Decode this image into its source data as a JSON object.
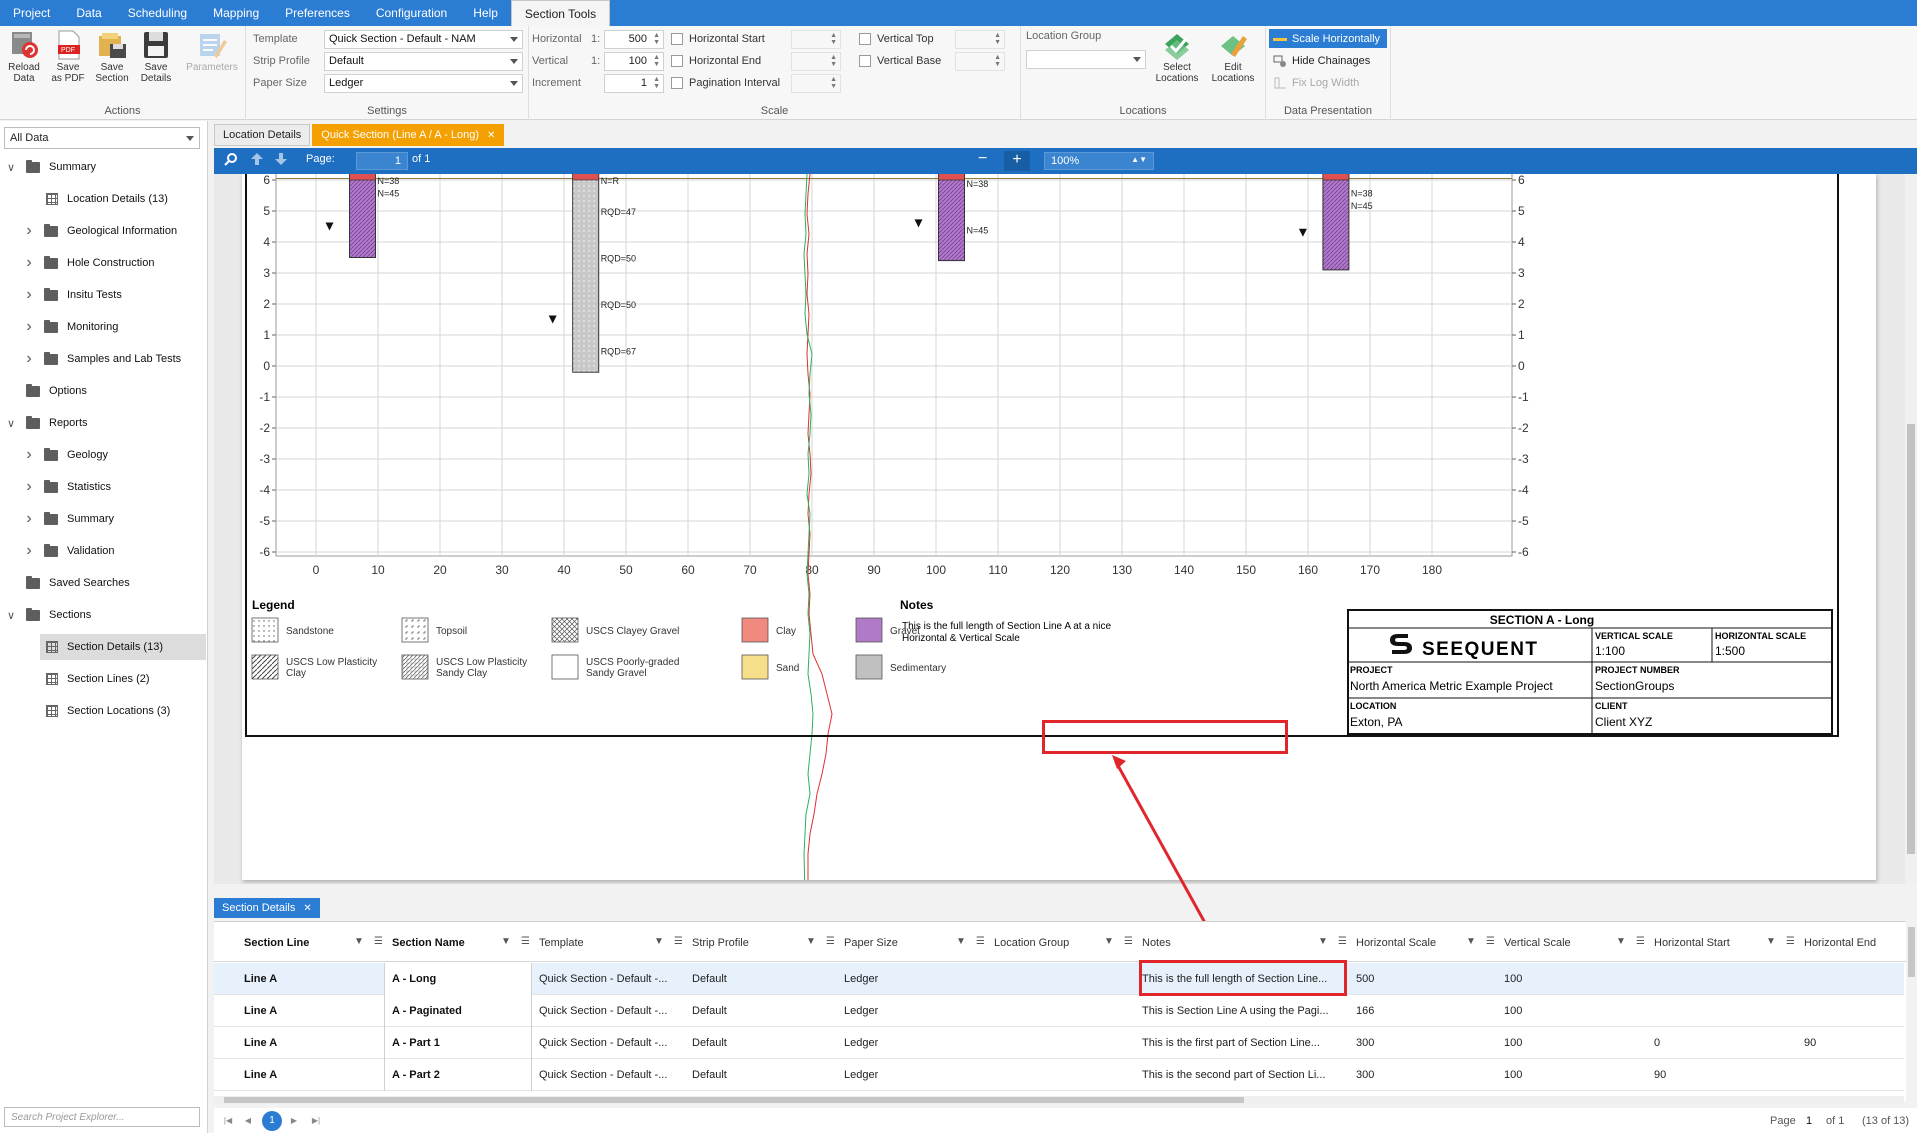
{
  "menu": [
    "Project",
    "Data",
    "Scheduling",
    "Mapping",
    "Preferences",
    "Configuration",
    "Help",
    "Section Tools"
  ],
  "ribbon": {
    "actions": {
      "title": "Actions",
      "buttons": [
        {
          "line1": "Reload",
          "line2": "Data"
        },
        {
          "line1": "Save",
          "line2": "as PDF"
        },
        {
          "line1": "Save",
          "line2": "Section"
        },
        {
          "line1": "Save",
          "line2": "Details"
        },
        {
          "line1": "Parameters",
          "line2": ""
        }
      ]
    },
    "settings": {
      "title": "Settings",
      "template_label": "Template",
      "template_value": "Quick Section - Default - NAM",
      "strip_label": "Strip Profile",
      "strip_value": "Default",
      "paper_label": "Paper Size",
      "paper_value": "Ledger"
    },
    "scale": {
      "title": "Scale",
      "horizontal_label": "Horizontal",
      "horizontal_ratio": "1:",
      "horizontal_value": "500",
      "vertical_label": "Vertical",
      "vertical_ratio": "1:",
      "vertical_value": "100",
      "increment_label": "Increment",
      "increment_value": "1",
      "horizontal_start": "Horizontal Start",
      "horizontal_end": "Horizontal End",
      "pagination_interval": "Pagination Interval",
      "vertical_top": "Vertical Top",
      "vertical_base": "Vertical Base"
    },
    "locations": {
      "title": "Locations",
      "location_group_label": "Location Group",
      "select_line1": "Select",
      "select_line2": "Locations",
      "edit_line1": "Edit",
      "edit_line2": "Locations"
    },
    "presentation": {
      "title": "Data Presentation",
      "scale_horizontally": "Scale Horizontally",
      "hide_chainages": "Hide Chainages",
      "fix_log_width": "Fix Log Width"
    }
  },
  "left": {
    "filter": "All Data",
    "search_placeholder": "Search Project Explorer...",
    "tree": [
      {
        "label": "Summary",
        "chev": "v",
        "icon": "folder",
        "level": 0
      },
      {
        "label": "Location Details (13)",
        "chev": "",
        "icon": "grid",
        "level": 2
      },
      {
        "label": "Geological Information",
        "chev": ">",
        "icon": "folder",
        "level": 1
      },
      {
        "label": "Hole Construction",
        "chev": ">",
        "icon": "folder",
        "level": 1
      },
      {
        "label": "Insitu Tests",
        "chev": ">",
        "icon": "folder",
        "level": 1
      },
      {
        "label": "Monitoring",
        "chev": ">",
        "icon": "folder",
        "level": 1
      },
      {
        "label": "Samples and Lab Tests",
        "chev": ">",
        "icon": "folder",
        "level": 1
      },
      {
        "label": "Options",
        "chev": "",
        "icon": "folder",
        "level": 0
      },
      {
        "label": "Reports",
        "chev": "v",
        "icon": "folder",
        "level": 0
      },
      {
        "label": "Geology",
        "chev": ">",
        "icon": "folder",
        "level": 1
      },
      {
        "label": "Statistics",
        "chev": ">",
        "icon": "folder",
        "level": 1
      },
      {
        "label": "Summary",
        "chev": ">",
        "icon": "folder",
        "level": 1
      },
      {
        "label": "Validation",
        "chev": ">",
        "icon": "folder",
        "level": 1
      },
      {
        "label": "Saved Searches",
        "chev": "",
        "icon": "folder",
        "level": 0
      },
      {
        "label": "Sections",
        "chev": "v",
        "icon": "folder",
        "level": 0
      },
      {
        "label": "Section Details (13)",
        "chev": "",
        "icon": "grid",
        "level": 2,
        "selected": true
      },
      {
        "label": "Section Lines (2)",
        "chev": "",
        "icon": "grid",
        "level": 2
      },
      {
        "label": "Section Locations (3)",
        "chev": "",
        "icon": "grid",
        "level": 2
      }
    ]
  },
  "tabs": {
    "location_details": "Location Details",
    "quick_section": "Quick Section (Line A / A - Long)"
  },
  "viewer": {
    "page_label": "Page:",
    "page_value": "1",
    "page_of": "of 1",
    "zoom": "100%",
    "minus": "−",
    "plus": "+"
  },
  "section": {
    "y_ticks": [
      "6",
      "5",
      "4",
      "3",
      "2",
      "1",
      "0",
      "-1",
      "-2",
      "-3",
      "-4",
      "-5",
      "-6"
    ],
    "x_ticks": [
      "0",
      "10",
      "20",
      "30",
      "40",
      "50",
      "60",
      "70",
      "80",
      "90",
      "100",
      "110",
      "120",
      "130",
      "140",
      "150",
      "160",
      "170",
      "180"
    ],
    "boreholes": [
      {
        "x_m": 7.5,
        "top_rl": 6.3,
        "base_rl": 3.5,
        "fill": "gravel",
        "water_rl": 4.5,
        "labels": [
          {
            "rl": 6.0,
            "text": "N=38"
          },
          {
            "rl": 5.6,
            "text": "N=45"
          }
        ]
      },
      {
        "x_m": 43.5,
        "top_rl": 6.3,
        "base_rl": -0.2,
        "fill": "rock",
        "water_rl": 1.5,
        "labels": [
          {
            "rl": 6.0,
            "text": "N=R"
          },
          {
            "rl": 5.0,
            "text": "RQD=47"
          },
          {
            "rl": 3.5,
            "text": "RQD=50"
          },
          {
            "rl": 2.0,
            "text": "RQD=50"
          },
          {
            "rl": 0.5,
            "text": "RQD=67"
          }
        ]
      },
      {
        "x_m": 102.5,
        "top_rl": 6.3,
        "base_rl": 3.4,
        "fill": "gravel",
        "water_rl": 4.6,
        "labels": [
          {
            "rl": 5.9,
            "text": "N=38"
          },
          {
            "rl": 4.4,
            "text": "N=45"
          }
        ]
      },
      {
        "x_m": 164.5,
        "top_rl": 6.3,
        "base_rl": 3.1,
        "fill": "gravel",
        "water_rl": 4.3,
        "labels": [
          {
            "rl": 5.6,
            "text": "N=38"
          },
          {
            "rl": 5.2,
            "text": "N=45"
          }
        ]
      }
    ],
    "legend_title": "Legend",
    "legend": [
      {
        "label": "Sandstone",
        "pattern": "dots"
      },
      {
        "label": "Topsoil",
        "pattern": "topsoil"
      },
      {
        "label": "USCS Clayey Gravel",
        "pattern": "cross"
      },
      {
        "label": "Clay",
        "color": "#f08a7e"
      },
      {
        "label": "Gravel",
        "color": "#b07ac9"
      },
      {
        "label": "USCS Low Plasticity Clay",
        "label2": "",
        "pattern": "hatch"
      },
      {
        "label": "USCS Low Plasticity",
        "label2": "Sandy Clay",
        "pattern": "hatch2"
      },
      {
        "label": "USCS Poorly-graded",
        "label2": "Sandy Gravel",
        "pattern": "cross2"
      },
      {
        "label": "Sand",
        "color": "#f6de8a"
      },
      {
        "label": "Sedimentary",
        "color": "#c0c0c0"
      }
    ],
    "notes_title": "Notes",
    "notes_line1": "This is the full length of Section Line A at a nice",
    "notes_line2": "Horizontal & Vertical Scale",
    "title_block": {
      "title": "SECTION A - Long",
      "logo": "SEEQUENT",
      "vscale_label": "VERTICAL SCALE",
      "vscale_value": "1:100",
      "hscale_label": "HORIZONTAL SCALE",
      "hscale_value": "1:500",
      "project_label": "PROJECT",
      "project_value": "North America Metric Example Project",
      "projno_label": "PROJECT NUMBER",
      "projno_value": "SectionGroups",
      "location_label": "LOCATION",
      "location_value": "Exton, PA",
      "client_label": "CLIENT",
      "client_value": "Client XYZ"
    }
  },
  "grid": {
    "tab": "Section Details",
    "columns": [
      "Section Line",
      "Section Name",
      "Template",
      "Strip Profile",
      "Paper Size",
      "Location Group",
      "Notes",
      "Horizontal Scale",
      "Vertical Scale",
      "Horizontal Start",
      "Horizontal End"
    ],
    "rows": [
      [
        "Line A",
        "A - Long",
        "Quick Section - Default -...",
        "Default",
        "Ledger",
        "",
        "This is the full length of Section Line...",
        "500",
        "100",
        "",
        ""
      ],
      [
        "Line A",
        "A - Paginated",
        "Quick Section - Default -...",
        "Default",
        "Ledger",
        "",
        "This is Section Line A using the Pagi...",
        "166",
        "100",
        "",
        ""
      ],
      [
        "Line A",
        "A - Part 1",
        "Quick Section - Default -...",
        "Default",
        "Ledger",
        "",
        "This is the first part of Section Line...",
        "300",
        "100",
        "0",
        "90"
      ],
      [
        "Line A",
        "A - Part 2",
        "Quick Section - Default -...",
        "Default",
        "Ledger",
        "",
        "This is the second part of Section Li...",
        "300",
        "100",
        "90",
        ""
      ]
    ]
  },
  "pager": {
    "current": "1",
    "page_label": "Page",
    "page_value": "1",
    "of_label": "of 1",
    "count": "(13 of 13)"
  },
  "colors": {
    "accent": "#2b7cd3",
    "active_tab": "#f4a000",
    "highlight": "#e0252b",
    "gravel": "#b07ac9",
    "rock": "#c8c8c8",
    "clay": "#f08a7e"
  }
}
